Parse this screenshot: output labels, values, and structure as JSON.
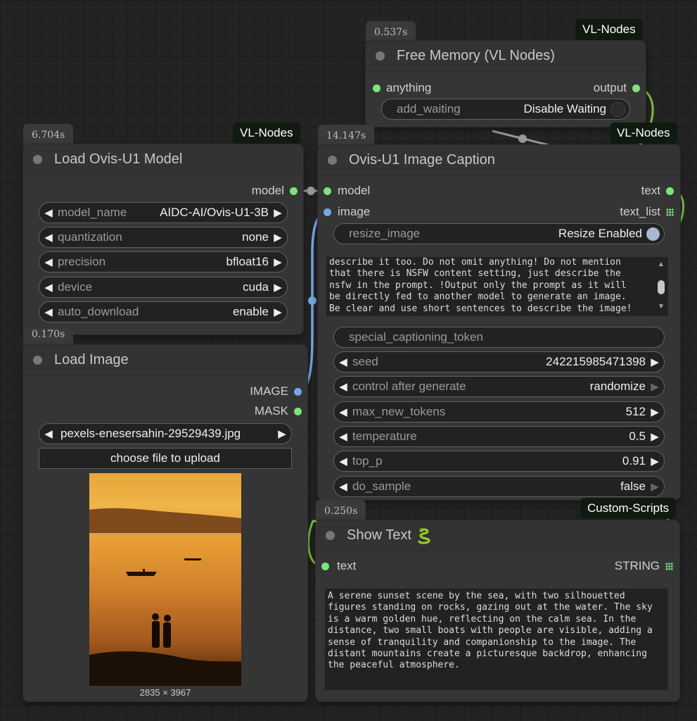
{
  "colors": {
    "canvas": "#232323",
    "node_body": "#353535",
    "slot_green": "#7be57b",
    "slot_blue": "#6fa8e8",
    "tag_bg": "#101a10",
    "link_green": "#7fbf3f",
    "link_blue": "#6fa8e8"
  },
  "free_memory": {
    "time": "0.537s",
    "tag": "VL-Nodes",
    "title": "Free Memory (VL Nodes)",
    "input": "anything",
    "output": "output",
    "toggle": {
      "label": "add_waiting",
      "value": "Disable Waiting"
    }
  },
  "load_model": {
    "time": "6.704s",
    "tag": "VL-Nodes",
    "title": "Load Ovis-U1 Model",
    "output": "model",
    "widgets": [
      {
        "label": "model_name",
        "value": "AIDC-AI/Ovis-U1-3B"
      },
      {
        "label": "quantization",
        "value": "none"
      },
      {
        "label": "precision",
        "value": "bfloat16"
      },
      {
        "label": "device",
        "value": "cuda"
      },
      {
        "label": "auto_download",
        "value": "enable"
      }
    ]
  },
  "caption": {
    "time": "14.147s",
    "tag": "VL-Nodes",
    "title": "Ovis-U1 Image Caption",
    "inputs": [
      "model",
      "image"
    ],
    "outputs": [
      "text",
      "text_list"
    ],
    "resize_toggle": {
      "label": "resize_image",
      "value": "Resize Enabled"
    },
    "prompt_text": "describe it too. Do not omit anything! Do not mention\nthat there is NSFW content setting, just describe the\nnsfw in the prompt. !Output only the prompt as it will\nbe directly fed to another model to generate an image.\nBe clear and use short sentences to describe the image!",
    "special_token_placeholder": "special_captioning_token",
    "widgets": [
      {
        "label": "seed",
        "value": "242215985471398"
      },
      {
        "label": "control after generate",
        "value": "randomize"
      },
      {
        "label": "max_new_tokens",
        "value": "512"
      },
      {
        "label": "temperature",
        "value": "0.5"
      },
      {
        "label": "top_p",
        "value": "0.91"
      },
      {
        "label": "do_sample",
        "value": "false"
      }
    ]
  },
  "load_image": {
    "time": "0.170s",
    "title": "Load Image",
    "outputs": [
      "IMAGE",
      "MASK"
    ],
    "file": "pexels-enesersahin-29529439.jpg",
    "upload_label": "choose file to upload",
    "dimensions": "2835 × 3967"
  },
  "show_text": {
    "time": "0.250s",
    "tag": "Custom-Scripts",
    "title": "Show Text",
    "title_icon": "snake-icon",
    "input": "text",
    "output": "STRING",
    "text": "A serene sunset scene by the sea, with two silhouetted\nfigures standing on rocks, gazing out at the water. The sky\nis a warm golden hue, reflecting on the calm sea. In the\ndistance, two small boats with people are visible, adding a\nsense of tranquility and companionship to the image. The\ndistant mountains create a picturesque backdrop, enhancing\nthe peaceful atmosphere."
  }
}
